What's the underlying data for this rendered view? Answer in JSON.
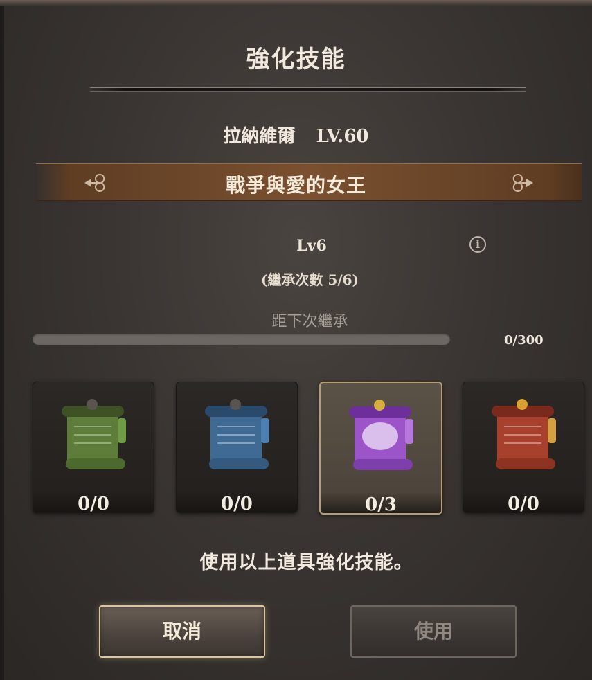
{
  "dialog": {
    "title": "強化技能"
  },
  "hero": {
    "name": "拉納維爾",
    "level_text": "LV.60"
  },
  "skill": {
    "name": "戰爭與愛的女王",
    "prev_icon": "arrow-left-icon",
    "next_icon": "arrow-right-icon",
    "level": "Lv6",
    "inherit_text": "(繼承次數 5/6)",
    "info_icon": "info-icon"
  },
  "progress": {
    "label": "距下次繼承",
    "value_text": "0/300",
    "fraction": 0
  },
  "items": [
    {
      "name": "green-scroll",
      "count": "0/0",
      "color": "#5f7d3a",
      "selected": false
    },
    {
      "name": "blue-scroll",
      "count": "0/0",
      "color": "#3f6a94",
      "selected": false
    },
    {
      "name": "purple-scroll",
      "count": "0/3",
      "color": "#9b55c8",
      "selected": true
    },
    {
      "name": "red-scroll",
      "count": "0/0",
      "color": "#a8402e",
      "selected": false
    }
  ],
  "prompt": "使用以上道具強化技能。",
  "buttons": {
    "cancel": "取消",
    "use": "使用"
  }
}
